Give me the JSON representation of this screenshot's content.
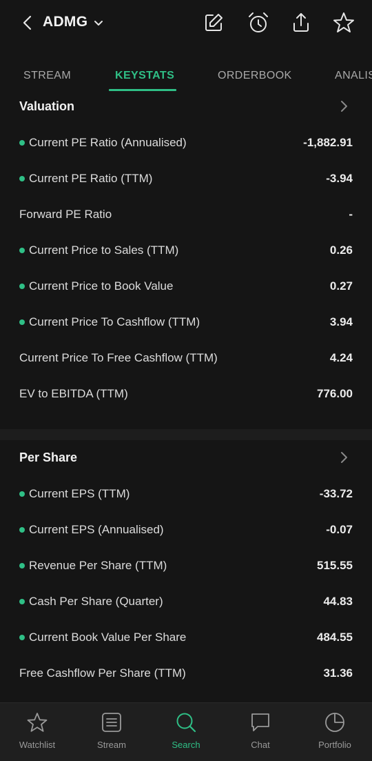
{
  "header": {
    "ticker": "ADMG",
    "icons": [
      "back-icon",
      "chevron-down-icon",
      "edit-icon",
      "alarm-icon",
      "share-icon",
      "star-icon"
    ]
  },
  "tabs": [
    {
      "label": "STREAM"
    },
    {
      "label": "KEYSTATS",
      "active": true
    },
    {
      "label": "ORDERBOOK"
    },
    {
      "label": "ANALIS"
    }
  ],
  "valuation": {
    "title": "Valuation",
    "rows": [
      {
        "label": "Current PE Ratio (Annualised)",
        "value": "-1,882.91",
        "dot": true
      },
      {
        "label": "Current PE Ratio (TTM)",
        "value": "-3.94",
        "dot": true
      },
      {
        "label": "Forward PE Ratio",
        "value": "-",
        "dot": false
      },
      {
        "label": "Current Price to Sales (TTM)",
        "value": "0.26",
        "dot": true
      },
      {
        "label": "Current Price to Book Value",
        "value": "0.27",
        "dot": true
      },
      {
        "label": "Current Price To Cashflow (TTM)",
        "value": "3.94",
        "dot": true
      },
      {
        "label": "Current Price To Free Cashflow (TTM)",
        "value": "4.24",
        "dot": false
      },
      {
        "label": "EV to EBITDA (TTM)",
        "value": "776.00",
        "dot": false
      }
    ]
  },
  "per_share": {
    "title": "Per Share",
    "rows": [
      {
        "label": "Current EPS (TTM)",
        "value": "-33.72",
        "dot": true
      },
      {
        "label": "Current EPS (Annualised)",
        "value": "-0.07",
        "dot": true
      },
      {
        "label": "Revenue Per Share (TTM)",
        "value": "515.55",
        "dot": true
      },
      {
        "label": "Cash Per Share (Quarter)",
        "value": "44.83",
        "dot": true
      },
      {
        "label": "Current Book Value Per Share",
        "value": "484.55",
        "dot": true
      },
      {
        "label": "Free Cashflow Per Share (TTM)",
        "value": "31.36",
        "dot": false
      }
    ]
  },
  "bottom_nav": [
    {
      "label": "Watchlist",
      "icon": "star-icon"
    },
    {
      "label": "Stream",
      "icon": "stream-icon"
    },
    {
      "label": "Search",
      "icon": "search-icon",
      "active": true
    },
    {
      "label": "Chat",
      "icon": "chat-icon"
    },
    {
      "label": "Portfolio",
      "icon": "pie-chart-icon"
    }
  ],
  "colors": {
    "accent": "#2fbf86",
    "background": "#151515",
    "nav_background": "#1f1f1f"
  }
}
